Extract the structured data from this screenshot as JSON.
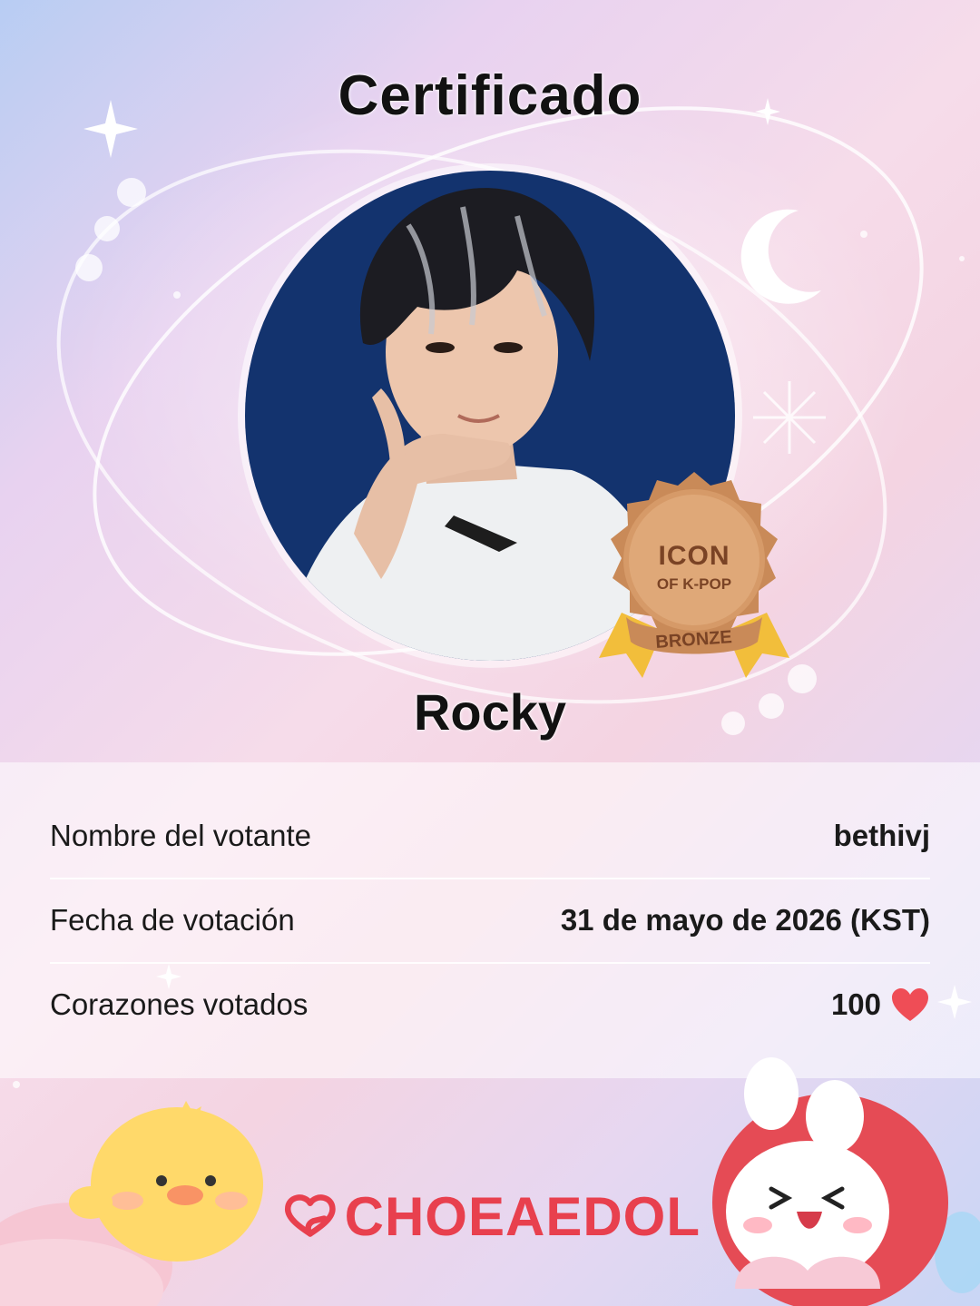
{
  "certificate": {
    "title": "Certificado",
    "idol_name": "Rocky"
  },
  "badge": {
    "line1": "ICON",
    "line2": "OF K-POP",
    "tier": "BRONZE"
  },
  "info": {
    "voter_label": "Nombre del votante",
    "voter_value": "bethivj",
    "date_label": "Fecha de votación",
    "date_value": "31 de mayo de 2026 (KST)",
    "hearts_label": "Corazones votados",
    "hearts_value": "100"
  },
  "brand": {
    "name": "CHOEAEDOL",
    "color": "#e8404e"
  },
  "icons": {
    "heart": "heart-icon",
    "moon": "crescent-moon-icon",
    "sparkle": "sparkle-icon"
  }
}
